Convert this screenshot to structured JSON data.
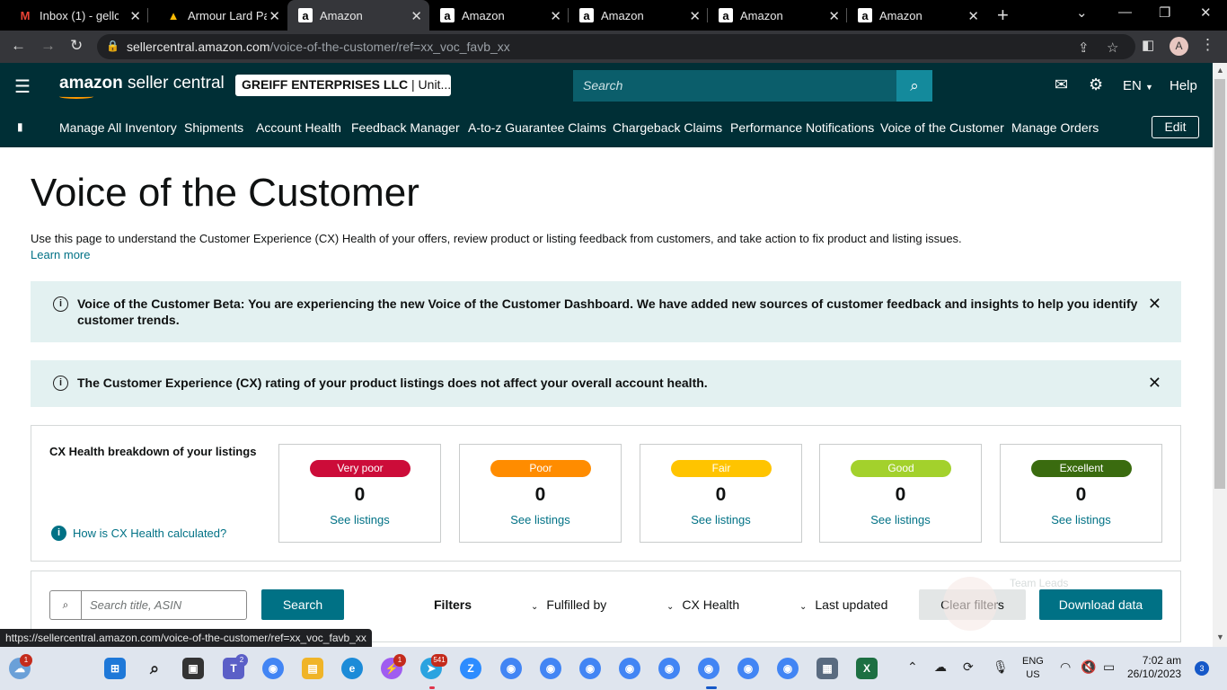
{
  "browser": {
    "tabs": [
      {
        "title": "Inbox (1) - gellc",
        "icon": "gmail-icon",
        "favicon_text": "M",
        "favicon_color": "#ea4335"
      },
      {
        "title": "Armour Lard Pail",
        "icon": "google-drive-icon",
        "favicon_text": "▲",
        "favicon_color": "#fbbc04"
      },
      {
        "title": "Amazon",
        "icon": "amazon-icon",
        "favicon_text": "a",
        "favicon_color": "#ffffff"
      },
      {
        "title": "Amazon",
        "icon": "amazon-icon",
        "favicon_text": "a",
        "favicon_color": "#ffffff"
      },
      {
        "title": "Amazon",
        "icon": "amazon-icon",
        "favicon_text": "a",
        "favicon_color": "#ffffff"
      },
      {
        "title": "Amazon",
        "icon": "amazon-icon",
        "favicon_text": "a",
        "favicon_color": "#ffffff"
      },
      {
        "title": "Amazon",
        "icon": "amazon-icon",
        "favicon_text": "a",
        "favicon_color": "#ffffff"
      }
    ],
    "active_tab": 2,
    "url_host": "sellercentral.amazon.com",
    "url_path": "/voice-of-the-customer/ref=xx_voc_favb_xx",
    "profile_initial": "A",
    "status_url": "https://sellercentral.amazon.com/voice-of-the-customer/ref=xx_voc_favb_xx"
  },
  "header": {
    "logo_bold": "amazon",
    "logo_rest": " seller central",
    "account_name": "GREIFF ENTERPRISES LLC",
    "account_suffix": " | Unit...",
    "search_placeholder": "Search",
    "language": "EN",
    "help": "Help"
  },
  "nav": {
    "links": [
      "Manage All Inventory",
      "Shipments",
      "Account Health",
      "Feedback Manager",
      "A-to-z Guarantee Claims",
      "Chargeback Claims",
      "Performance Notifications",
      "Voice of the Customer",
      "Manage Orders"
    ],
    "edit": "Edit"
  },
  "page": {
    "title": "Voice of the Customer",
    "description": "Use this page to understand the Customer Experience (CX) Health of your offers, review product or listing feedback from customers, and take action to fix product and listing issues.",
    "learn_more": "Learn more"
  },
  "alerts": [
    {
      "text_line1": "Voice of the Customer Beta: You are experiencing the new Voice of the Customer Dashboard. We have added new sources of customer feedback and insights to help you identify",
      "text_line2": "customer trends."
    },
    {
      "text_line1": "The Customer Experience (CX) rating of your product listings does not affect your overall account health.",
      "text_line2": ""
    }
  ],
  "cx_health": {
    "title": "CX Health breakdown of your listings",
    "help_link": "How is CX Health calculated?",
    "cards": [
      {
        "label": "Very poor",
        "count": "0",
        "link": "See listings",
        "color": "#cc0c39"
      },
      {
        "label": "Poor",
        "count": "0",
        "link": "See listings",
        "color": "#ff8c00"
      },
      {
        "label": "Fair",
        "count": "0",
        "link": "See listings",
        "color": "#ffc400"
      },
      {
        "label": "Good",
        "count": "0",
        "link": "See listings",
        "color": "#a3d12c"
      },
      {
        "label": "Excellent",
        "count": "0",
        "link": "See listings",
        "color": "#3a6b0f"
      }
    ]
  },
  "filters": {
    "search_placeholder": "Search title, ASIN",
    "search_button": "Search",
    "filters_label": "Filters",
    "dropdowns": [
      "Fulfilled by",
      "CX Health",
      "Last updated"
    ],
    "clear_button": "Clear filters",
    "download_button": "Download data",
    "ghost_text": "Team Leads"
  },
  "taskbar": {
    "weather_badge": "1",
    "teams_badge": "2",
    "messenger_badge": "1",
    "telegram_badge": "541",
    "lang_line1": "ENG",
    "lang_line2": "US",
    "time": "7:02 am",
    "date": "26/10/2023",
    "notifications": "3"
  }
}
